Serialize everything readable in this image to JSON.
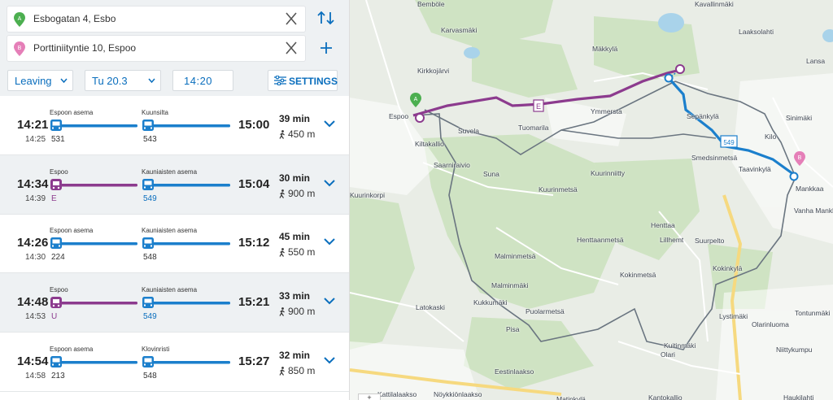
{
  "search": {
    "origin": "Esbogatan 4, Esbo",
    "destination": "Porttiniityntie 10, Espoo",
    "origin_marker": "A",
    "destination_marker": "B",
    "mode": "Leaving",
    "date": "Tu 20.3",
    "time": "14:20",
    "settings_label": "SETTINGS"
  },
  "colors": {
    "bus": "#1b7fcc",
    "train": "#8c3b8e",
    "accent": "#0a6ebd",
    "origin": "#4caf50",
    "destination": "#e57fb8"
  },
  "itineraries": [
    {
      "dep": "14:21",
      "first_vehicle": "14:25",
      "arr": "15:00",
      "duration": "39 min",
      "walk": "450 m",
      "stop1": "Espoon asema",
      "stop2": "Kuunsilta",
      "route1": "531",
      "route2": "543",
      "mode1": "bus",
      "mode2": "bus"
    },
    {
      "dep": "14:34",
      "first_vehicle": "14:39",
      "arr": "15:04",
      "duration": "30 min",
      "walk": "900 m",
      "stop1": "Espoo",
      "stop2": "Kauniaisten asema",
      "route1": "E",
      "route2": "549",
      "mode1": "train",
      "mode2": "bus"
    },
    {
      "dep": "14:26",
      "first_vehicle": "14:30",
      "arr": "15:12",
      "duration": "45 min",
      "walk": "550 m",
      "stop1": "Espoon asema",
      "stop2": "Kauniaisten asema",
      "route1": "224",
      "route2": "548",
      "mode1": "bus",
      "mode2": "bus"
    },
    {
      "dep": "14:48",
      "first_vehicle": "14:53",
      "arr": "15:21",
      "duration": "33 min",
      "walk": "900 m",
      "stop1": "Espoo",
      "stop2": "Kauniaisten asema",
      "route1": "U",
      "route2": "549",
      "mode1": "train",
      "mode2": "bus"
    },
    {
      "dep": "14:54",
      "first_vehicle": "14:58",
      "arr": "15:27",
      "duration": "32 min",
      "walk": "850 m",
      "stop1": "Espoon asema",
      "stop2": "Klovinristi",
      "route1": "213",
      "route2": "548",
      "mode1": "bus",
      "mode2": "bus"
    }
  ],
  "map": {
    "train_label": "E",
    "bus_label": "549",
    "origin_marker": "A",
    "destination_marker": "B",
    "zoom_in": "+",
    "places": [
      "Bemböle",
      "Kavallinmäki",
      "Karvasmäki",
      "Laaksolahti",
      "Lansa",
      "Kirkkojärvi",
      "Mäkkylä",
      "Espoo",
      "Ymmersta",
      "Sepänkylä",
      "Sinimäki",
      "Tuomarila",
      "Suvela",
      "Kilo",
      "Smedsinmetsä",
      "Kiltakallio",
      "Saarniraivio",
      "Suna",
      "Taavinkylä",
      "Kuurinniitty",
      "Mankkaa",
      "Vanha Mankkaa",
      "Kuurinmetsä",
      "Henttaa",
      "Lillhemt",
      "Suurpelto",
      "Henttaanmetsä",
      "Malminmetsä",
      "Kokinkylä",
      "Kokinmetsä",
      "Malminmäki",
      "Latokaski",
      "Kukkumäki",
      "Puolarmetsä",
      "Lystimäki",
      "Tontunmäki",
      "Olarinluoma",
      "Pisa",
      "Kuitinmäki",
      "Olari",
      "Niittykumpu",
      "Eestinlaakso",
      "Kattilalaakso",
      "Nöykkiönlaakso",
      "Matinkylä",
      "Kantokallio",
      "Haukilahti",
      "Kuurinkorpi"
    ]
  }
}
